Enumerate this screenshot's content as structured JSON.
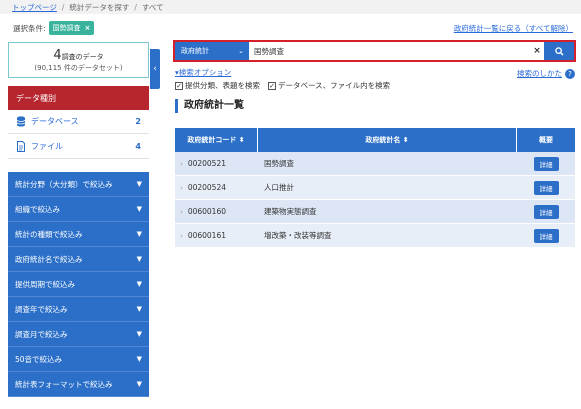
{
  "breadcrumb": {
    "home": "トップページ",
    "search": "統計データを探す",
    "current": "すべて"
  },
  "condition": {
    "label": "選択条件:",
    "tag": "国勢調査",
    "tag_close": "×",
    "back_link": "政府統計一覧に戻る（すべて解除）"
  },
  "counts": {
    "number": "4",
    "unit": "調査のデータ",
    "sub": "(90,115 件のデータセット)"
  },
  "sidebar": {
    "collapse_glyph": "‹",
    "data_type_heading": "データ種別",
    "types": [
      {
        "label": "データベース",
        "count": "2",
        "icon": "database-icon"
      },
      {
        "label": "ファイル",
        "count": "4",
        "icon": "file-icon"
      }
    ],
    "filters": [
      "統計分野（大分類）で絞込み",
      "組織で絞込み",
      "統計の種類で絞込み",
      "政府統計名で絞込み",
      "提供周期で絞込み",
      "調査年で絞込み",
      "調査月で絞込み",
      "50音で絞込み",
      "統計表フォーマットで絞込み"
    ]
  },
  "search": {
    "scope": "政府統計",
    "query": "国勢調査",
    "clear_glyph": "×",
    "button_glyph": "⚲"
  },
  "options": {
    "link": "▾検索オプション",
    "howto": "検索のしかた",
    "howto_glyph": "?"
  },
  "checkboxes": [
    {
      "label": "提供分類、表題を検索",
      "checked": true
    },
    {
      "label": "データベース、ファイル内を検索",
      "checked": true
    }
  ],
  "list": {
    "title": "政府統計一覧",
    "headers": {
      "code": "政府統計コード ⬍",
      "name": "政府統計名 ⬍",
      "summary": "概要"
    },
    "rows": [
      {
        "code": "00200521",
        "name": "国勢調査",
        "action": "詳細"
      },
      {
        "code": "00200524",
        "name": "人口推計",
        "action": "詳細"
      },
      {
        "code": "00600160",
        "name": "建築物実態調査",
        "action": "詳細"
      },
      {
        "code": "00600161",
        "name": "増改築・改装等調査",
        "action": "詳細"
      }
    ]
  },
  "colors": {
    "primary_blue": "#2b6fc9",
    "data_type_red": "#b7252f",
    "tag_teal": "#39b39b",
    "search_border": "#d4202a"
  }
}
